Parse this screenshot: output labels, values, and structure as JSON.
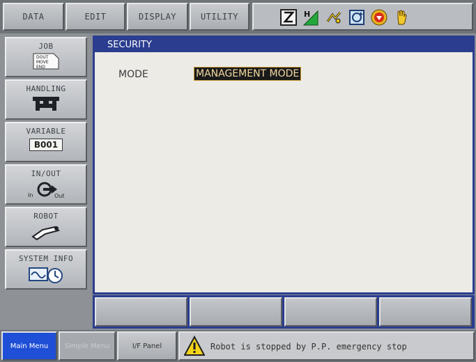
{
  "top_menu": [
    {
      "label": "DATA"
    },
    {
      "label": "EDIT"
    },
    {
      "label": "DISPLAY"
    },
    {
      "label": "UTILITY"
    }
  ],
  "status_icons": [
    {
      "name": "teach-mode-icon",
      "glyph": "Z"
    },
    {
      "name": "speed-level-icon",
      "glyph": "H"
    },
    {
      "name": "coordinate-icon"
    },
    {
      "name": "cycle-icon"
    },
    {
      "name": "stop-icon"
    },
    {
      "name": "hand-icon"
    }
  ],
  "main_menu": {
    "job": {
      "label": "JOB",
      "icon_lines": [
        "DOUT",
        "MOVE",
        "END"
      ]
    },
    "handling": {
      "label": "HANDLING"
    },
    "variable": {
      "label": "VARIABLE",
      "value": "B001"
    },
    "in_out": {
      "label": "IN/OUT",
      "in_text": "In",
      "out_text": "Out"
    },
    "robot": {
      "label": "ROBOT"
    },
    "system_info": {
      "label": "SYSTEM INFO"
    }
  },
  "window": {
    "title": "SECURITY",
    "mode_label": "MODE",
    "mode_value": "MANAGEMENT MODE"
  },
  "bottom": {
    "main_menu": "Main Menu",
    "simple_menu": "Simple Menu",
    "if_panel": "I/F Panel",
    "message": "Robot is stopped by P.P. emergency stop"
  },
  "colors": {
    "title_bar": "#2a3d8f",
    "main_menu_active": "#1f4fd6",
    "mode_highlight": "#1a1a1a",
    "warning": "#f2d21b"
  }
}
